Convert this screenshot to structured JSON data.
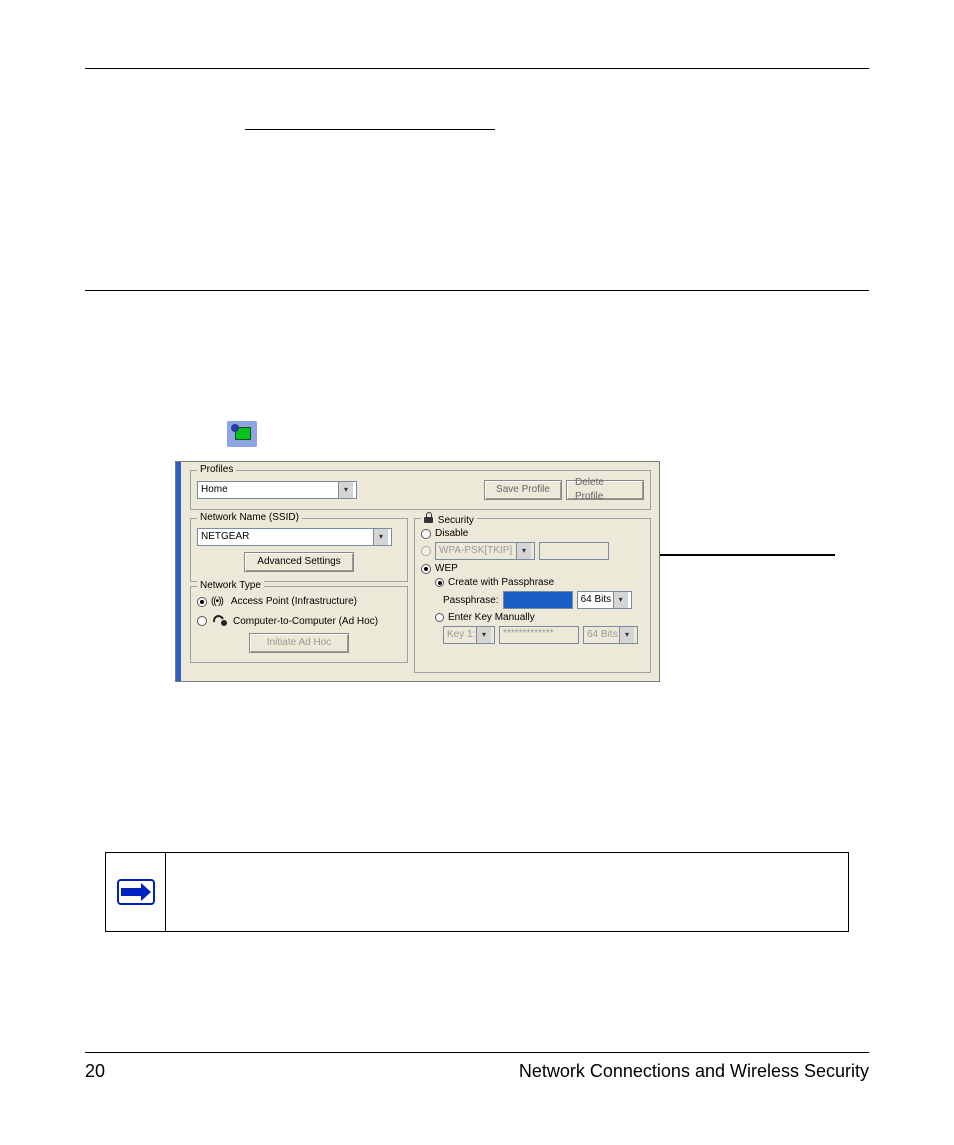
{
  "header_rule": true,
  "underline_placeholder": " ",
  "icon_alt": "system-tray-icon",
  "dialog": {
    "profiles": {
      "group_title": "Profiles",
      "selected": "Home",
      "save_btn": "Save Profile",
      "delete_btn": "Delete Profile"
    },
    "network_name": {
      "group_title": "Network Name (SSID)",
      "value": "NETGEAR",
      "advanced_btn": "Advanced Settings"
    },
    "network_type": {
      "group_title": "Network Type",
      "ap_label": "Access Point (Infrastructure)",
      "adhoc_label": "Computer-to-Computer (Ad Hoc)",
      "initiate_btn": "Initiate Ad Hoc"
    },
    "security": {
      "group_title": "Security",
      "disable": "Disable",
      "wpa_label": "WPA-PSK[TKIP]",
      "wep": "WEP",
      "create_pass": "Create with Passphrase",
      "pass_label": "Passphrase:",
      "pass_value": "******",
      "pass_bits": "64 Bits",
      "enter_key": "Enter Key Manually",
      "key_label": "Key 1:",
      "key_value": "*************",
      "key_bits": "64 Bits"
    }
  },
  "footer": {
    "page": "20",
    "title": "Network Connections and Wireless Security"
  }
}
